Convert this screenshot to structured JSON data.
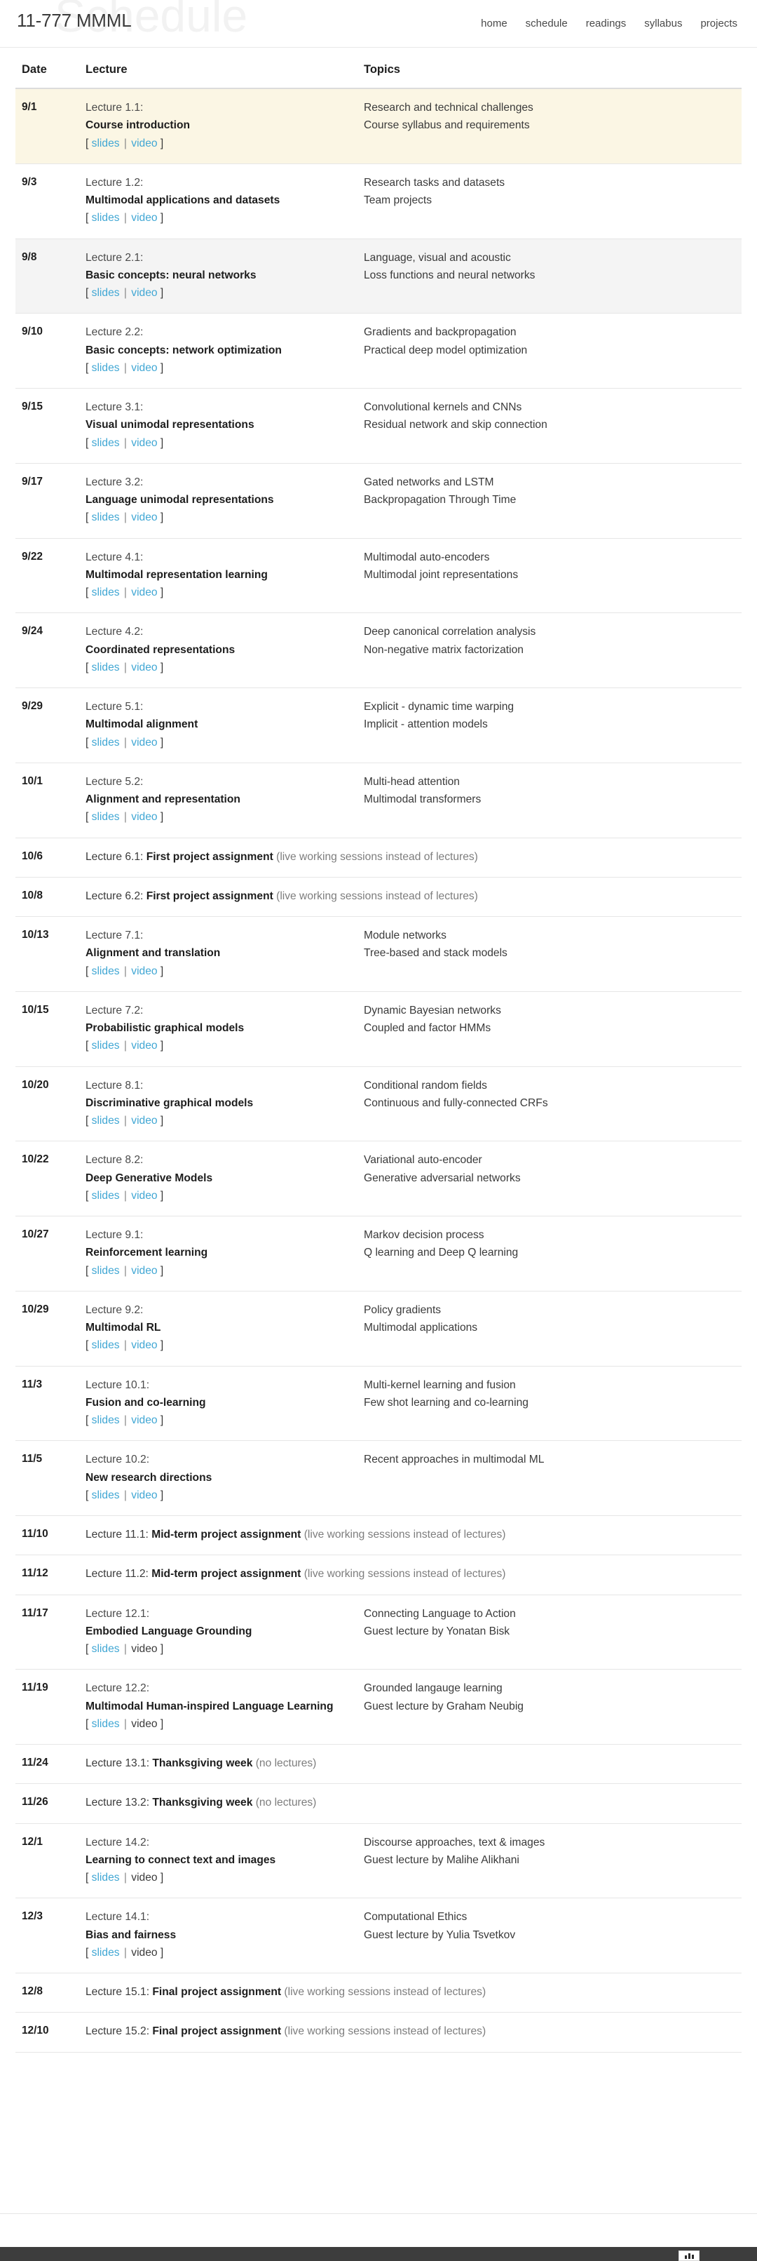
{
  "header": {
    "watermark": "Schedule",
    "brand": "11-777 MMML",
    "nav": [
      {
        "label": "home"
      },
      {
        "label": "schedule"
      },
      {
        "label": "readings"
      },
      {
        "label": "syllabus"
      },
      {
        "label": "projects"
      }
    ]
  },
  "table": {
    "columns": {
      "date": "Date",
      "lecture": "Lecture",
      "topics": "Topics"
    },
    "link_labels": {
      "open": "[",
      "slides": "slides",
      "separator": "|",
      "video": "video",
      "close": "]"
    },
    "rows": [
      {
        "kind": "lecture",
        "style": "highlight",
        "date": "9/1",
        "lecture_num": "Lecture 1.1:",
        "lecture_title": "Course introduction",
        "slides_link": true,
        "video_link": true,
        "topics": [
          "Research and technical challenges",
          "Course syllabus and requirements"
        ]
      },
      {
        "kind": "lecture",
        "style": "plain",
        "date": "9/3",
        "lecture_num": "Lecture 1.2:",
        "lecture_title": "Multimodal applications and datasets",
        "slides_link": true,
        "video_link": true,
        "topics": [
          "Research tasks and datasets",
          "Team projects"
        ]
      },
      {
        "kind": "lecture",
        "style": "stripe",
        "date": "9/8",
        "lecture_num": "Lecture 2.1:",
        "lecture_title": "Basic concepts: neural networks",
        "slides_link": true,
        "video_link": true,
        "topics": [
          "Language, visual and acoustic",
          "Loss functions and neural networks"
        ]
      },
      {
        "kind": "lecture",
        "style": "plain",
        "date": "9/10",
        "lecture_num": "Lecture 2.2:",
        "lecture_title": "Basic concepts: network optimization",
        "slides_link": true,
        "video_link": true,
        "topics": [
          "Gradients and backpropagation",
          "Practical deep model optimization"
        ]
      },
      {
        "kind": "lecture",
        "style": "plain",
        "date": "9/15",
        "lecture_num": "Lecture 3.1:",
        "lecture_title": "Visual unimodal representations",
        "slides_link": true,
        "video_link": true,
        "topics": [
          "Convolutional kernels and CNNs",
          "Residual network and skip connection"
        ]
      },
      {
        "kind": "lecture",
        "style": "plain",
        "date": "9/17",
        "lecture_num": "Lecture 3.2:",
        "lecture_title": "Language unimodal representations",
        "slides_link": true,
        "video_link": true,
        "topics": [
          "Gated networks and LSTM",
          "Backpropagation Through Time"
        ]
      },
      {
        "kind": "lecture",
        "style": "plain",
        "date": "9/22",
        "lecture_num": "Lecture 4.1:",
        "lecture_title": "Multimodal representation learning",
        "slides_link": true,
        "video_link": true,
        "topics": [
          "Multimodal auto-encoders",
          "Multimodal joint representations"
        ]
      },
      {
        "kind": "lecture",
        "style": "plain",
        "date": "9/24",
        "lecture_num": "Lecture 4.2:",
        "lecture_title": "Coordinated representations",
        "slides_link": true,
        "video_link": true,
        "topics": [
          "Deep canonical correlation analysis",
          "Non-negative matrix factorization"
        ]
      },
      {
        "kind": "lecture",
        "style": "plain",
        "date": "9/29",
        "lecture_num": "Lecture 5.1:",
        "lecture_title": "Multimodal alignment",
        "slides_link": true,
        "video_link": true,
        "topics": [
          "Explicit - dynamic time warping",
          "Implicit - attention models"
        ]
      },
      {
        "kind": "lecture",
        "style": "plain",
        "date": "10/1",
        "lecture_num": "Lecture 5.2:",
        "lecture_title": "Alignment and representation",
        "slides_link": true,
        "video_link": true,
        "topics": [
          "Multi-head attention",
          "Multimodal transformers"
        ]
      },
      {
        "kind": "span",
        "style": "plain",
        "date": "10/6",
        "span_prefix": "Lecture 6.1: ",
        "span_bold": "First project assignment",
        "span_note": " (live working sessions instead of lectures)"
      },
      {
        "kind": "span",
        "style": "plain",
        "date": "10/8",
        "span_prefix": "Lecture 6.2: ",
        "span_bold": "First project assignment",
        "span_note": " (live working sessions instead of lectures)"
      },
      {
        "kind": "lecture",
        "style": "plain",
        "date": "10/13",
        "lecture_num": "Lecture 7.1:",
        "lecture_title": "Alignment and translation",
        "slides_link": true,
        "video_link": true,
        "topics": [
          "Module networks",
          "Tree-based and stack models"
        ]
      },
      {
        "kind": "lecture",
        "style": "plain",
        "date": "10/15",
        "lecture_num": "Lecture 7.2:",
        "lecture_title": "Probabilistic graphical models",
        "slides_link": true,
        "video_link": true,
        "topics": [
          "Dynamic Bayesian networks",
          "Coupled and factor HMMs"
        ]
      },
      {
        "kind": "lecture",
        "style": "plain",
        "date": "10/20",
        "lecture_num": "Lecture 8.1:",
        "lecture_title": "Discriminative graphical models",
        "slides_link": true,
        "video_link": true,
        "topics": [
          "Conditional random fields",
          "Continuous and fully-connected CRFs"
        ]
      },
      {
        "kind": "lecture",
        "style": "plain",
        "date": "10/22",
        "lecture_num": "Lecture 8.2:",
        "lecture_title": "Deep Generative Models",
        "slides_link": true,
        "video_link": true,
        "topics": [
          "Variational auto-encoder",
          "Generative adversarial networks"
        ]
      },
      {
        "kind": "lecture",
        "style": "plain",
        "date": "10/27",
        "lecture_num": "Lecture 9.1:",
        "lecture_title": "Reinforcement learning",
        "slides_link": true,
        "video_link": true,
        "topics": [
          "Markov decision process",
          "Q learning and Deep Q learning"
        ]
      },
      {
        "kind": "lecture",
        "style": "plain",
        "date": "10/29",
        "lecture_num": "Lecture 9.2:",
        "lecture_title": "Multimodal RL",
        "slides_link": true,
        "video_link": true,
        "topics": [
          "Policy gradients",
          "Multimodal applications"
        ]
      },
      {
        "kind": "lecture",
        "style": "plain",
        "date": "11/3",
        "lecture_num": "Lecture 10.1:",
        "lecture_title": "Fusion and co-learning",
        "slides_link": true,
        "video_link": true,
        "topics": [
          "Multi-kernel learning and fusion",
          "Few shot learning and co-learning"
        ]
      },
      {
        "kind": "lecture",
        "style": "plain",
        "date": "11/5",
        "lecture_num": "Lecture 10.2:",
        "lecture_title": "New research directions",
        "slides_link": true,
        "video_link": true,
        "topics": [
          "Recent approaches in multimodal ML"
        ]
      },
      {
        "kind": "span",
        "style": "plain",
        "date": "11/10",
        "span_prefix": "Lecture 11.1: ",
        "span_bold": "Mid-term project assignment",
        "span_note": " (live working sessions instead of lectures)"
      },
      {
        "kind": "span",
        "style": "plain",
        "date": "11/12",
        "span_prefix": "Lecture 11.2: ",
        "span_bold": "Mid-term project assignment",
        "span_note": " (live working sessions instead of lectures)"
      },
      {
        "kind": "lecture",
        "style": "plain",
        "date": "11/17",
        "lecture_num": "Lecture 12.1:",
        "lecture_title": "Embodied Language Grounding",
        "slides_link": true,
        "video_link": false,
        "topics": [
          "Connecting Language to Action",
          "Guest lecture by Yonatan Bisk"
        ]
      },
      {
        "kind": "lecture",
        "style": "plain",
        "date": "11/19",
        "lecture_num": "Lecture 12.2:",
        "lecture_title": "Multimodal Human-inspired Language Learning",
        "slides_link": true,
        "video_link": false,
        "topics": [
          "Grounded langauge learning",
          "Guest lecture by Graham Neubig"
        ]
      },
      {
        "kind": "span",
        "style": "plain",
        "date": "11/24",
        "span_prefix": "Lecture 13.1: ",
        "span_bold": "Thanksgiving week",
        "span_note": " (no lectures)"
      },
      {
        "kind": "span",
        "style": "plain",
        "date": "11/26",
        "span_prefix": "Lecture 13.2: ",
        "span_bold": "Thanksgiving week",
        "span_note": " (no lectures)"
      },
      {
        "kind": "lecture",
        "style": "plain",
        "date": "12/1",
        "lecture_num": "Lecture 14.2:",
        "lecture_title": "Learning to connect text and images",
        "slides_link": true,
        "video_link": false,
        "topics": [
          "Discourse approaches, text & images",
          "Guest lecture by Malihe Alikhani"
        ]
      },
      {
        "kind": "lecture",
        "style": "plain",
        "date": "12/3",
        "lecture_num": "Lecture 14.1:",
        "lecture_title": "Bias and fairness",
        "slides_link": true,
        "video_link": false,
        "topics": [
          "Computational Ethics",
          "Guest lecture by Yulia Tsvetkov"
        ]
      },
      {
        "kind": "span",
        "style": "plain",
        "date": "12/8",
        "span_prefix": "Lecture 15.1: ",
        "span_bold": "Final project assignment",
        "span_note": " (live working sessions instead of lectures)"
      },
      {
        "kind": "span",
        "style": "plain",
        "date": "12/10",
        "span_prefix": "Lecture 15.2: ",
        "span_bold": "Final project assignment",
        "span_note": " (live working sessions instead of lectures)"
      }
    ]
  },
  "footer": {
    "badge_icon": "chart-badge-icon"
  },
  "colors": {
    "link": "#41a7d4",
    "highlight_row": "#fbf6e4",
    "stripe_row": "#f4f4f4",
    "footer_bar": "#3d3d3d",
    "text": "#3a3a3a"
  }
}
